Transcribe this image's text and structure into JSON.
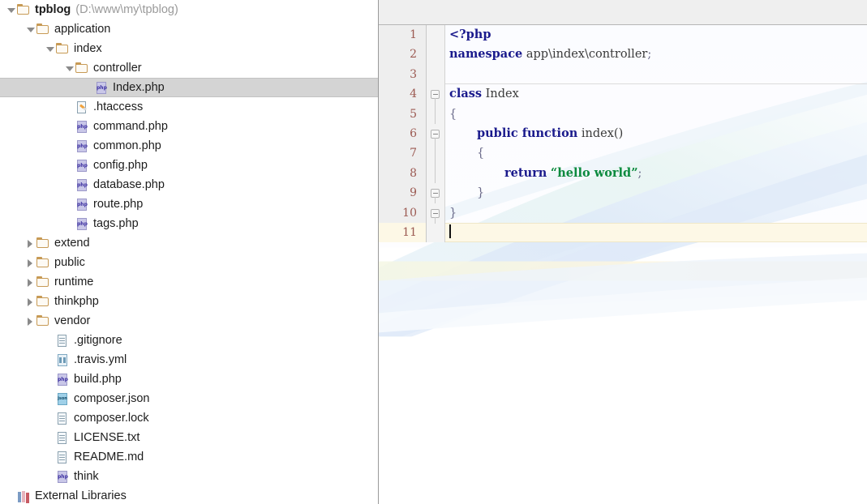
{
  "project_tree": {
    "name": "project-tree",
    "items": [
      {
        "label": "tpblog",
        "path_suffix": "(D:\\www\\my\\tpblog)",
        "icon": "folder-icon",
        "arrow": "down",
        "indent": 0,
        "bold": true,
        "selected": false
      },
      {
        "label": "application",
        "path_suffix": "",
        "icon": "folder-icon",
        "arrow": "down",
        "indent": 1,
        "bold": false,
        "selected": false
      },
      {
        "label": "index",
        "path_suffix": "",
        "icon": "folder-icon",
        "arrow": "down",
        "indent": 2,
        "bold": false,
        "selected": false
      },
      {
        "label": "controller",
        "path_suffix": "",
        "icon": "folder-icon",
        "arrow": "down",
        "indent": 3,
        "bold": false,
        "selected": false
      },
      {
        "label": "Index.php",
        "path_suffix": "",
        "icon": "php-file-icon",
        "arrow": "none",
        "indent": 4,
        "bold": false,
        "selected": true
      },
      {
        "label": ".htaccess",
        "path_suffix": "",
        "icon": "htaccess-file-icon",
        "arrow": "none",
        "indent": 3,
        "bold": false,
        "selected": false
      },
      {
        "label": "command.php",
        "path_suffix": "",
        "icon": "php-file-icon",
        "arrow": "none",
        "indent": 3,
        "bold": false,
        "selected": false
      },
      {
        "label": "common.php",
        "path_suffix": "",
        "icon": "php-file-icon",
        "arrow": "none",
        "indent": 3,
        "bold": false,
        "selected": false
      },
      {
        "label": "config.php",
        "path_suffix": "",
        "icon": "php-file-icon",
        "arrow": "none",
        "indent": 3,
        "bold": false,
        "selected": false
      },
      {
        "label": "database.php",
        "path_suffix": "",
        "icon": "php-file-icon",
        "arrow": "none",
        "indent": 3,
        "bold": false,
        "selected": false
      },
      {
        "label": "route.php",
        "path_suffix": "",
        "icon": "php-file-icon",
        "arrow": "none",
        "indent": 3,
        "bold": false,
        "selected": false
      },
      {
        "label": "tags.php",
        "path_suffix": "",
        "icon": "php-file-icon",
        "arrow": "none",
        "indent": 3,
        "bold": false,
        "selected": false
      },
      {
        "label": "extend",
        "path_suffix": "",
        "icon": "folder-icon",
        "arrow": "right",
        "indent": 1,
        "bold": false,
        "selected": false
      },
      {
        "label": "public",
        "path_suffix": "",
        "icon": "folder-icon",
        "arrow": "right",
        "indent": 1,
        "bold": false,
        "selected": false
      },
      {
        "label": "runtime",
        "path_suffix": "",
        "icon": "folder-icon",
        "arrow": "right",
        "indent": 1,
        "bold": false,
        "selected": false
      },
      {
        "label": "thinkphp",
        "path_suffix": "",
        "icon": "folder-icon",
        "arrow": "right",
        "indent": 1,
        "bold": false,
        "selected": false
      },
      {
        "label": "vendor",
        "path_suffix": "",
        "icon": "folder-icon",
        "arrow": "right",
        "indent": 1,
        "bold": false,
        "selected": false
      },
      {
        "label": ".gitignore",
        "path_suffix": "",
        "icon": "text-file-icon",
        "arrow": "none",
        "indent": 2,
        "bold": false,
        "selected": false
      },
      {
        "label": ".travis.yml",
        "path_suffix": "",
        "icon": "yml-file-icon",
        "arrow": "none",
        "indent": 2,
        "bold": false,
        "selected": false
      },
      {
        "label": "build.php",
        "path_suffix": "",
        "icon": "php-file-icon",
        "arrow": "none",
        "indent": 2,
        "bold": false,
        "selected": false
      },
      {
        "label": "composer.json",
        "path_suffix": "",
        "icon": "json-file-icon",
        "arrow": "none",
        "indent": 2,
        "bold": false,
        "selected": false
      },
      {
        "label": "composer.lock",
        "path_suffix": "",
        "icon": "text-file-icon",
        "arrow": "none",
        "indent": 2,
        "bold": false,
        "selected": false
      },
      {
        "label": "LICENSE.txt",
        "path_suffix": "",
        "icon": "text-file-icon",
        "arrow": "none",
        "indent": 2,
        "bold": false,
        "selected": false
      },
      {
        "label": "README.md",
        "path_suffix": "",
        "icon": "text-file-icon",
        "arrow": "none",
        "indent": 2,
        "bold": false,
        "selected": false
      },
      {
        "label": "think",
        "path_suffix": "",
        "icon": "php-file-icon",
        "arrow": "none",
        "indent": 2,
        "bold": false,
        "selected": false
      },
      {
        "label": "External Libraries",
        "path_suffix": "",
        "icon": "books-icon",
        "arrow": "none",
        "indent": 0,
        "bold": false,
        "selected": false
      }
    ]
  },
  "editor": {
    "language": "php",
    "current_line": 11,
    "colors": {
      "keyword": "#1a1a8c",
      "string": "#0b8a3e",
      "line_number": "#9c5a52",
      "gutter_bg": "#eeeeee",
      "current_line_bg": "#fdf8e6",
      "selection_bg": "#d4d4d4"
    },
    "line_numbers": [
      "1",
      "2",
      "3",
      "4",
      "5",
      "6",
      "7",
      "8",
      "9",
      "10",
      "11"
    ],
    "lines": [
      {
        "num": "1",
        "indent": 0,
        "fold": "none",
        "tokens": [
          {
            "t": "<?php",
            "c": "kw"
          }
        ]
      },
      {
        "num": "2",
        "indent": 0,
        "fold": "none",
        "tokens": [
          {
            "t": "namespace",
            "c": "kw"
          },
          {
            "t": " app\\index\\controller",
            "c": "plain"
          },
          {
            "t": ";",
            "c": "punct"
          }
        ]
      },
      {
        "num": "3",
        "indent": 0,
        "fold": "none",
        "tokens": []
      },
      {
        "num": "4",
        "indent": 0,
        "fold": "minus",
        "tokens": [
          {
            "t": "class",
            "c": "kw"
          },
          {
            "t": " Index",
            "c": "plain"
          }
        ]
      },
      {
        "num": "5",
        "indent": 0,
        "fold": "line",
        "tokens": [
          {
            "t": "{",
            "c": "punct"
          }
        ]
      },
      {
        "num": "6",
        "indent": 1,
        "fold": "minus",
        "tokens": [
          {
            "t": "public function",
            "c": "kw"
          },
          {
            "t": " index()",
            "c": "plain"
          }
        ]
      },
      {
        "num": "7",
        "indent": 1,
        "fold": "line",
        "tokens": [
          {
            "t": "{",
            "c": "punct"
          }
        ]
      },
      {
        "num": "8",
        "indent": 2,
        "fold": "line",
        "tokens": [
          {
            "t": "return",
            "c": "kw"
          },
          {
            "t": " ",
            "c": "plain"
          },
          {
            "t": "“hello world”",
            "c": "str"
          },
          {
            "t": ";",
            "c": "punct"
          }
        ]
      },
      {
        "num": "9",
        "indent": 1,
        "fold": "minus",
        "tokens": [
          {
            "t": "}",
            "c": "punct"
          }
        ]
      },
      {
        "num": "10",
        "indent": 0,
        "fold": "minus",
        "tokens": [
          {
            "t": "}",
            "c": "punct"
          }
        ]
      },
      {
        "num": "11",
        "indent": 0,
        "fold": "none",
        "tokens": [],
        "caret": true
      }
    ]
  }
}
